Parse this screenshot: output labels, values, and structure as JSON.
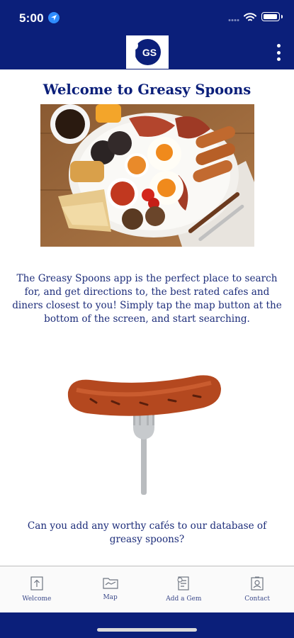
{
  "status": {
    "time": "5:00",
    "icons": [
      "location-icon",
      "signal-icon",
      "wifi-icon",
      "battery-icon"
    ]
  },
  "header": {
    "logo_text": "GS",
    "menu_icon": "more-vertical-icon"
  },
  "main": {
    "title": "Welcome to Greasy Spoons",
    "intro": "The Greasy Spoons app is the perfect place to search for, and get directions to, the best rated cafes and diners closest to you! Simply tap the map button at the bottom of the screen, and start searching.",
    "question": "Can you add any worthy cafés to our database of greasy spoons?",
    "images": [
      "full-english-breakfast-image",
      "sausage-on-fork-image"
    ]
  },
  "tabs": [
    {
      "label": "Welcome",
      "icon": "upload-icon"
    },
    {
      "label": "Map",
      "icon": "folder-icon"
    },
    {
      "label": "Add a Gem",
      "icon": "document-add-icon"
    },
    {
      "label": "Contact",
      "icon": "contact-card-icon"
    }
  ],
  "colors": {
    "brand": "#0b1f7a",
    "text": "#1d2d7a",
    "tabbar_bg": "#fafafa"
  }
}
